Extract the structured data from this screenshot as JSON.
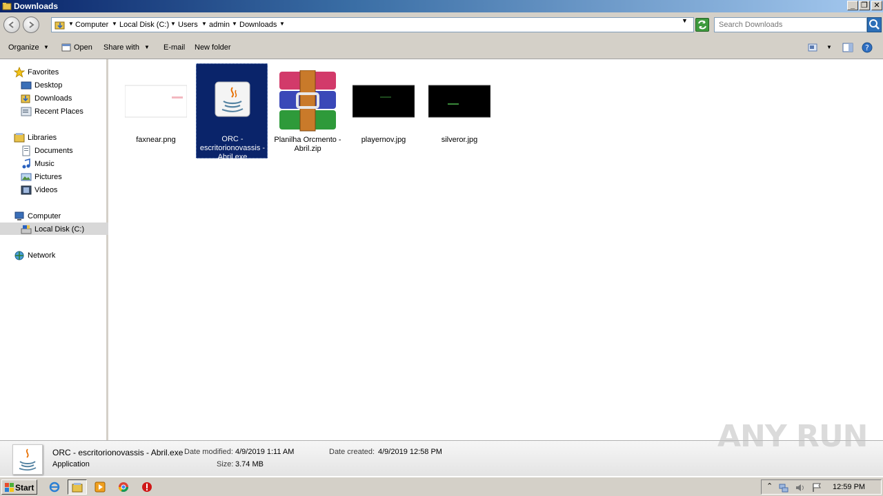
{
  "window": {
    "title": "Downloads"
  },
  "address": {
    "crumbs": [
      "Computer",
      "Local Disk (C:)",
      "Users",
      "admin",
      "Downloads"
    ],
    "search_placeholder": "Search Downloads"
  },
  "toolbar": {
    "organize": "Organize",
    "open": "Open",
    "share_with": "Share with",
    "email": "E-mail",
    "new_folder": "New folder"
  },
  "sidebar": {
    "favorites": "Favorites",
    "desktop": "Desktop",
    "downloads": "Downloads",
    "recent_places": "Recent Places",
    "libraries": "Libraries",
    "documents": "Documents",
    "music": "Music",
    "pictures": "Pictures",
    "videos": "Videos",
    "computer": "Computer",
    "local_disk": "Local Disk (C:)",
    "network": "Network"
  },
  "files": [
    {
      "name": "faxnear.png",
      "icon": "image-thumbnail-icon"
    },
    {
      "name": "ORC - escritorionovassis - Abril.exe",
      "icon": "java-icon",
      "selected": true
    },
    {
      "name": "Planilha Orcmento - Abril.zip",
      "icon": "winrar-archive-icon"
    },
    {
      "name": "playernov.jpg",
      "icon": "image-thumbnail-icon"
    },
    {
      "name": "silveror.jpg",
      "icon": "image-thumbnail-icon"
    }
  ],
  "details": {
    "name": "ORC - escritorionovassis - Abril.exe",
    "type": "Application",
    "date_modified_label": "Date modified:",
    "date_modified": "4/9/2019 1:11 AM",
    "size_label": "Size:",
    "size": "3.74 MB",
    "date_created_label": "Date created:",
    "date_created": "4/9/2019 12:58 PM"
  },
  "watermark": "ANY RUN",
  "taskbar": {
    "start": "Start",
    "clock": "12:59 PM"
  },
  "colors": {
    "selection": "#0a246a",
    "chrome": "#d4d0c8"
  }
}
